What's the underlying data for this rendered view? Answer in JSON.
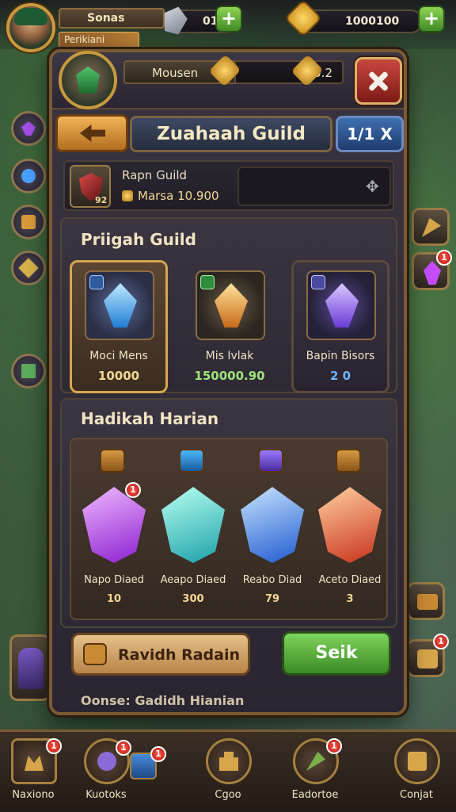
{
  "top_bar": {
    "player_name": "Sonas",
    "player_rank": "Perikiani",
    "gems_value": "01",
    "gold_value": "1000100"
  },
  "guild_header": {
    "guild_name": "Mousen",
    "guild_gold": "0.2",
    "title": "Zuahaah Guild",
    "page_indicator": "1/1 X"
  },
  "guild_info": {
    "name": "Rapn Guild",
    "gold": "Marsa 10.900",
    "emblem_level": "92"
  },
  "premium_section": {
    "title": "Priigah Guild",
    "cards": [
      {
        "name": "Moci Mens",
        "price": "10000",
        "price_color": "#f3d891",
        "gem_color": "#4ab8ff",
        "selected": true
      },
      {
        "name": "Mis Ivlak",
        "price": "150000.90",
        "price_color": "#9fe37a",
        "gem_color": "#f0a23a",
        "selected": false
      },
      {
        "name": "Bapin Bisors",
        "price": "2 0",
        "price_color": "#6fb4ff",
        "gem_color": "#9a7cff",
        "selected": false
      }
    ]
  },
  "daily_section": {
    "title": "Hadikah Harian",
    "items": [
      {
        "name": "Napo Diaed",
        "price": "10",
        "gem_color": "#c54cff",
        "has_badge": true,
        "badge": "1"
      },
      {
        "name": "Aeapo Diaed",
        "price": "300",
        "gem_color": "#3ed2d8",
        "has_badge": false,
        "badge": ""
      },
      {
        "name": "Reabo Diad",
        "price": "79",
        "gem_color": "#3e8cff",
        "has_badge": false,
        "badge": ""
      },
      {
        "name": "Aceto Diaed",
        "price": "3",
        "gem_color": "#ff6a2a",
        "has_badge": false,
        "badge": ""
      }
    ]
  },
  "actions": {
    "history_label": "Ravidh Radain",
    "buy_label": "Seik"
  },
  "footer_text": "Oonse: Gadidh Hianian",
  "bottom_nav": [
    {
      "label": "Naxiono",
      "badge": "1"
    },
    {
      "label": "Kuotoks",
      "badge": "1"
    },
    {
      "label": "Cgoo",
      "badge": ""
    },
    {
      "label": "Eadortoe",
      "badge": "1"
    },
    {
      "label": "Conjat",
      "badge": ""
    }
  ],
  "side_badges": {
    "right_gem_badge": "1",
    "right_lower_badge": "1"
  },
  "colors": {
    "accent_gold": "#c79a3e",
    "buy_green": "#4fa832",
    "close_red": "#b8322a",
    "panel_bg": "#2f2a35"
  },
  "icons": {
    "gems": "gray-crystal-icon",
    "gold": "gold-coin-icon",
    "add": "plus-icon",
    "close": "close-icon",
    "back": "arrow-left-icon"
  }
}
